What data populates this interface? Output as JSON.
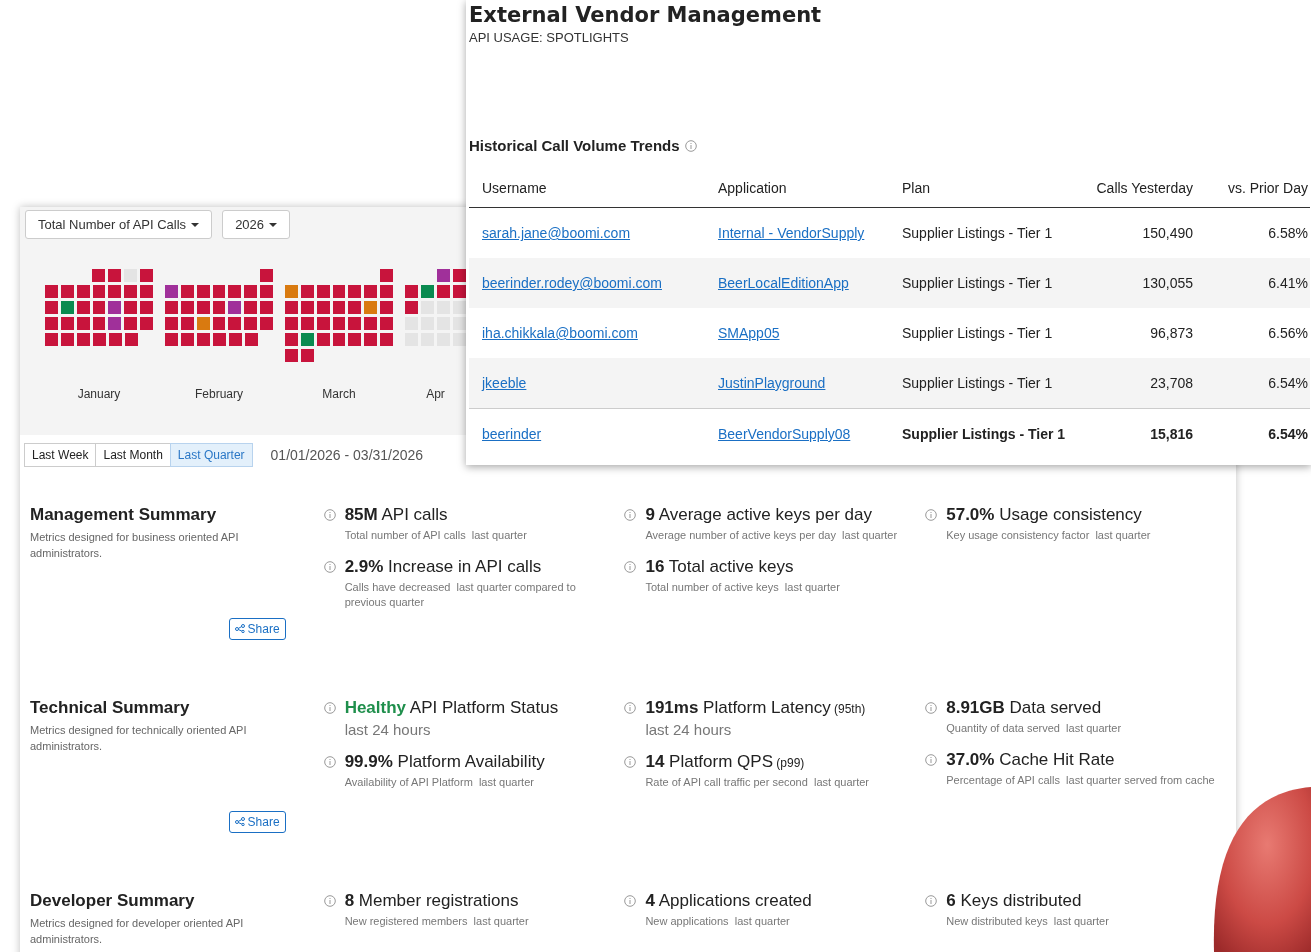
{
  "dashboard": {
    "metric_dropdown": "Total Number of API Calls",
    "year_dropdown": "2026",
    "calendar": [
      {
        "label": "January",
        "weeks": [
          [
            {
              "color": "#c8143c"
            },
            {
              "color": "#c8143c"
            },
            {
              "color": "#e4e4e4"
            },
            {
              "color": "#c8143c"
            }
          ],
          [
            {
              "color": "#c8143c"
            },
            {
              "color": "#c8143c"
            },
            {
              "color": "#c8143c"
            },
            {
              "color": "#c8143c"
            },
            {
              "color": "#c8143c"
            },
            {
              "color": "#c8143c"
            },
            {
              "color": "#c8143c"
            }
          ],
          [
            {
              "color": "#c8143c"
            },
            {
              "color": "#0a8a50"
            },
            {
              "color": "#c8143c"
            },
            {
              "color": "#c8143c"
            },
            {
              "color": "#a0309a"
            },
            {
              "color": "#c8143c"
            },
            {
              "color": "#c8143c"
            }
          ],
          [
            {
              "color": "#c8143c"
            },
            {
              "color": "#c8143c"
            },
            {
              "color": "#c8143c"
            },
            {
              "color": "#c8143c"
            },
            {
              "color": "#a0309a"
            },
            {
              "color": "#c8143c"
            },
            {
              "color": "#c8143c"
            }
          ],
          [
            {
              "color": "#c8143c"
            },
            {
              "color": "#c8143c"
            },
            {
              "color": "#c8143c"
            },
            {
              "color": "#c8143c"
            },
            {
              "color": "#c8143c"
            },
            {
              "color": "#c8143c"
            }
          ]
        ]
      },
      {
        "label": "February",
        "weeks": [
          [
            {
              "color": "#c8143c"
            }
          ],
          [
            {
              "color": "#a0309a"
            },
            {
              "color": "#c8143c"
            },
            {
              "color": "#c8143c"
            },
            {
              "color": "#c8143c"
            },
            {
              "color": "#c8143c"
            },
            {
              "color": "#c8143c"
            },
            {
              "color": "#c8143c"
            }
          ],
          [
            {
              "color": "#c8143c"
            },
            {
              "color": "#c8143c"
            },
            {
              "color": "#c8143c"
            },
            {
              "color": "#c8143c"
            },
            {
              "color": "#a0309a"
            },
            {
              "color": "#c8143c"
            },
            {
              "color": "#c8143c"
            }
          ],
          [
            {
              "color": "#c8143c"
            },
            {
              "color": "#c8143c"
            },
            {
              "color": "#d97a10"
            },
            {
              "color": "#c8143c"
            },
            {
              "color": "#c8143c"
            },
            {
              "color": "#c8143c"
            },
            {
              "color": "#c8143c"
            }
          ],
          [
            {
              "color": "#c8143c"
            },
            {
              "color": "#c8143c"
            },
            {
              "color": "#c8143c"
            },
            {
              "color": "#c8143c"
            },
            {
              "color": "#c8143c"
            },
            {
              "color": "#c8143c"
            }
          ]
        ]
      },
      {
        "label": "March",
        "weeks": [
          [
            {
              "color": "#c8143c"
            }
          ],
          [
            {
              "color": "#d97a10"
            },
            {
              "color": "#c8143c"
            },
            {
              "color": "#c8143c"
            },
            {
              "color": "#c8143c"
            },
            {
              "color": "#c8143c"
            },
            {
              "color": "#c8143c"
            },
            {
              "color": "#c8143c"
            }
          ],
          [
            {
              "color": "#c8143c"
            },
            {
              "color": "#c8143c"
            },
            {
              "color": "#c8143c"
            },
            {
              "color": "#c8143c"
            },
            {
              "color": "#c8143c"
            },
            {
              "color": "#d97a10"
            },
            {
              "color": "#c8143c"
            }
          ],
          [
            {
              "color": "#c8143c"
            },
            {
              "color": "#c8143c"
            },
            {
              "color": "#c8143c"
            },
            {
              "color": "#c8143c"
            },
            {
              "color": "#c8143c"
            },
            {
              "color": "#c8143c"
            },
            {
              "color": "#c8143c"
            }
          ],
          [
            {
              "color": "#c8143c"
            },
            {
              "color": "#0a8a50"
            },
            {
              "color": "#c8143c"
            },
            {
              "color": "#c8143c"
            },
            {
              "color": "#c8143c"
            },
            {
              "color": "#c8143c"
            },
            {
              "color": "#c8143c"
            }
          ],
          [
            {
              "color": "#c8143c"
            },
            {
              "color": "#c8143c"
            }
          ]
        ]
      },
      {
        "label": "Apr",
        "weeks": [
          [
            {
              "color": "#a0309a"
            },
            {
              "color": "#c8143c"
            }
          ],
          [
            {
              "color": "#c8143c"
            },
            {
              "color": "#0a8a50"
            },
            {
              "color": "#c8143c"
            },
            {
              "color": "#c8143c"
            }
          ],
          [
            {
              "color": "#c8143c"
            },
            {
              "color": "#e4e4e4"
            },
            {
              "color": "#e4e4e4"
            },
            {
              "color": "#e4e4e4"
            }
          ],
          [
            {
              "color": "#e4e4e4"
            },
            {
              "color": "#e4e4e4"
            },
            {
              "color": "#e4e4e4"
            },
            {
              "color": "#e4e4e4"
            }
          ],
          [
            {
              "color": "#e4e4e4"
            },
            {
              "color": "#e4e4e4"
            },
            {
              "color": "#e4e4e4"
            },
            {
              "color": "#e4e4e4"
            }
          ]
        ]
      }
    ],
    "range_tabs": [
      {
        "label": "Last Week",
        "selected": false
      },
      {
        "label": "Last Month",
        "selected": false
      },
      {
        "label": "Last Quarter",
        "selected": true
      }
    ],
    "date_range": "01/01/2026 - 03/31/2026",
    "sections": [
      {
        "title": "Management Summary",
        "description": "Metrics designed for business oriented API administrators.",
        "share": "Share",
        "columns": [
          [
            {
              "kind": "metric",
              "value": "85M",
              "label": "API calls",
              "description": "Total number of API calls",
              "period": "last quarter"
            },
            {
              "kind": "metric",
              "value": "2.9%",
              "label": "Increase in API calls",
              "description": "Calls have decreased",
              "period": "last quarter compared to  previous quarter"
            }
          ],
          [
            {
              "kind": "metric",
              "value": "9",
              "label": "Average active keys per day",
              "description": "Average number of active keys per day",
              "period": "last quarter"
            },
            {
              "kind": "metric",
              "value": "16",
              "label": "Total active keys",
              "description": "Total number of active keys",
              "period": "last quarter"
            }
          ],
          [
            {
              "kind": "metric",
              "value": "57.0%",
              "label": "Usage consistency",
              "description": "Key usage consistency factor",
              "period": "last quarter"
            }
          ]
        ]
      },
      {
        "title": "Technical Summary",
        "description": "Metrics designed for technically oriented API administrators.",
        "share": "Share",
        "columns": [
          [
            {
              "kind": "status",
              "value": "Healthy",
              "label": "API Platform Status",
              "period": "last 24 hours"
            },
            {
              "kind": "metric",
              "value": "99.9%",
              "label": "Platform Availability",
              "description": "Availability of API Platform",
              "period": "last quarter"
            }
          ],
          [
            {
              "kind": "metric",
              "value": "191ms",
              "label": "Platform Latency",
              "qualifier": "(95th)",
              "period": "last 24 hours"
            },
            {
              "kind": "metric",
              "value": "14",
              "label": "Platform QPS",
              "qualifier": "(p99)",
              "description": "Rate of API call traffic per second",
              "period": "last quarter"
            }
          ],
          [
            {
              "kind": "metric",
              "value": "8.91GB",
              "label": "Data served",
              "description": "Quantity of data served",
              "period": "last quarter"
            },
            {
              "kind": "metric",
              "value": "37.0%",
              "label": "Cache Hit Rate",
              "description": "Percentage of API calls",
              "period": "last quarter served from cache"
            }
          ]
        ]
      },
      {
        "title": "Developer Summary",
        "description": "Metrics designed for developer oriented API administrators.",
        "columns": [
          [
            {
              "kind": "metric",
              "value": "8",
              "label": "Member registrations",
              "description": "New registered members",
              "period": "last quarter"
            }
          ],
          [
            {
              "kind": "metric",
              "value": "4",
              "label": "Applications created",
              "description": "New applications",
              "period": "last quarter"
            }
          ],
          [
            {
              "kind": "metric",
              "value": "6",
              "label": "Keys distributed",
              "description": "New distributed keys",
              "period": "last quarter"
            }
          ]
        ]
      }
    ]
  },
  "vendor_panel": {
    "title": "External Vendor Management",
    "subtitle": "API USAGE: SPOTLIGHTS",
    "table_title": "Historical Call Volume Trends",
    "columns": [
      "Username",
      "Application",
      "Plan",
      "Calls Yesterday",
      "vs. Prior Day"
    ],
    "rows": [
      {
        "bold": false,
        "cells": [
          "sarah.jane@boomi.com",
          "Internal - VendorSupply",
          "Supplier Listings - Tier 1",
          "150,490",
          "6.58%"
        ]
      },
      {
        "bold": false,
        "cells": [
          "beerinder.rodey@boomi.com",
          "BeerLocalEditionApp",
          "Supplier Listings - Tier 1",
          "130,055",
          "6.41%"
        ]
      },
      {
        "bold": false,
        "cells": [
          "iha.chikkala@boomi.com",
          "SMApp05",
          "Supplier Listings - Tier 1",
          "96,873",
          "6.56%"
        ]
      },
      {
        "bold": false,
        "cells": [
          "jkeeble",
          "JustinPlayground",
          "Supplier Listings - Tier 1",
          "23,708",
          "6.54%"
        ]
      },
      {
        "bold": true,
        "cells": [
          "beerinder",
          "BeerVendorSupply08",
          "Supplier Listings - Tier 1",
          "15,816",
          "6.54%"
        ]
      }
    ]
  }
}
